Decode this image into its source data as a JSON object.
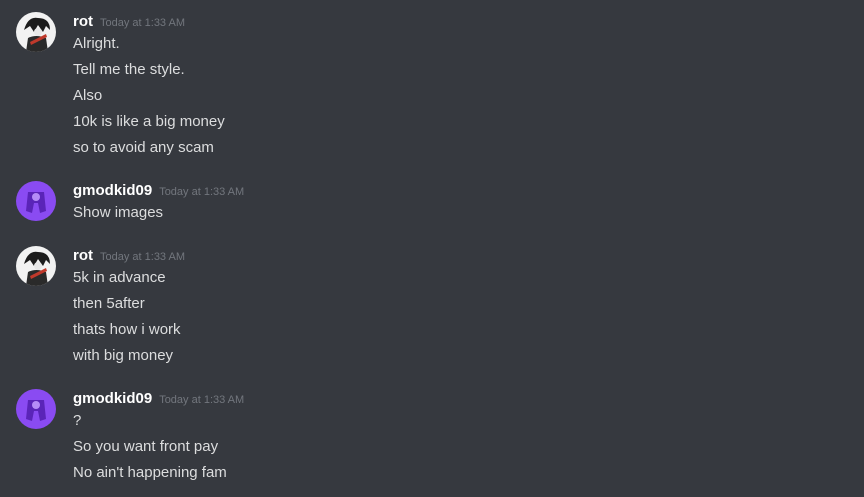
{
  "colors": {
    "background": "#36393f",
    "username": "#ffffff",
    "timestamp": "#72767d",
    "message_text": "#dcddde",
    "purple_avatar": "#8a4bf2"
  },
  "messages": [
    {
      "author": "rot",
      "avatar_icon": "anime-character-avatar-icon",
      "timestamp": "Today at 1:33 AM",
      "lines": [
        "Alright.",
        "Tell me the style.",
        "Also",
        "10k is like a big money",
        "so to avoid any scam"
      ]
    },
    {
      "author": "gmodkid09",
      "avatar_icon": "purple-avatar-icon",
      "timestamp": "Today at 1:33 AM",
      "lines": [
        "Show images"
      ]
    },
    {
      "author": "rot",
      "avatar_icon": "anime-character-avatar-icon",
      "timestamp": "Today at 1:33 AM",
      "lines": [
        "5k in advance",
        "then 5after",
        "thats how i work",
        "with big money"
      ]
    },
    {
      "author": "gmodkid09",
      "avatar_icon": "purple-avatar-icon",
      "timestamp": "Today at 1:33 AM",
      "lines": [
        "?",
        "So you want front pay",
        "No ain't happening fam"
      ]
    }
  ]
}
